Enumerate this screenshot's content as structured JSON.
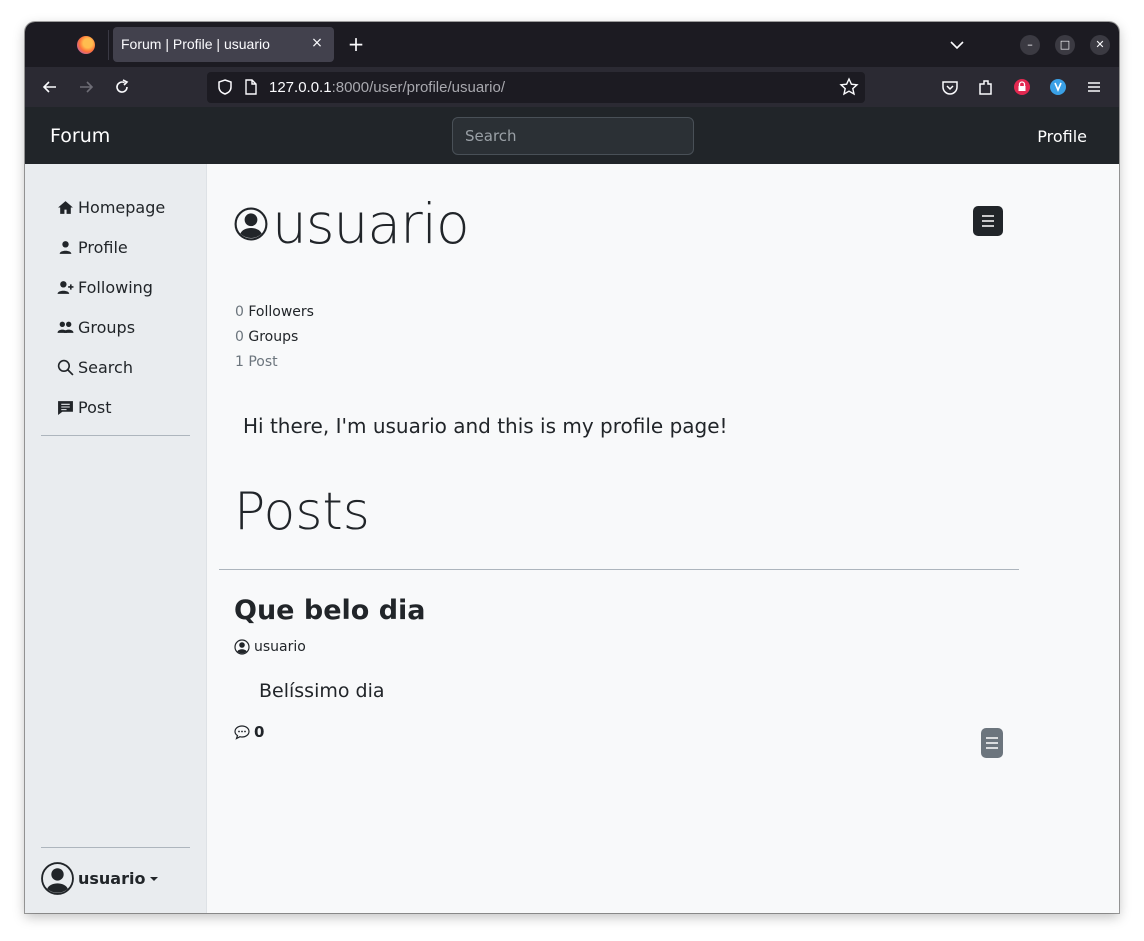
{
  "browser": {
    "tab_title": "Forum | Profile | usuario",
    "tab_close": "×",
    "new_tab": "+",
    "url_host": "127.0.0.1",
    "url_rest": ":8000/user/profile/usuario/",
    "window_controls": {
      "minimize": "–",
      "maximize": "□",
      "close": "✕"
    }
  },
  "topnav": {
    "brand": "Forum",
    "search_placeholder": "Search",
    "profile_link": "Profile"
  },
  "sidebar": {
    "items": [
      {
        "label": "Homepage",
        "icon": "house-icon"
      },
      {
        "label": "Profile",
        "icon": "person-icon"
      },
      {
        "label": "Following",
        "icon": "person-plus-icon"
      },
      {
        "label": "Groups",
        "icon": "people-icon"
      },
      {
        "label": "Search",
        "icon": "search-icon"
      },
      {
        "label": "Post",
        "icon": "chat-square-icon"
      }
    ],
    "user": {
      "name": "usuario"
    }
  },
  "profile": {
    "username": "usuario",
    "stats": {
      "followers_count": "0",
      "followers_label": "Followers",
      "groups_count": "0",
      "groups_label": "Groups",
      "posts_text": "1 Post"
    },
    "bio": "Hi there, I'm usuario and this is my profile page!",
    "posts_heading": "Posts",
    "posts": [
      {
        "title": "Que belo dia",
        "author": "usuario",
        "body": "Belíssimo dia",
        "comments": "0"
      }
    ]
  },
  "colors": {
    "navbar": "#212529",
    "sidebar": "#e9ecef",
    "page_bg": "#f8f9fa",
    "browser_tabstrip": "#1c1b22"
  }
}
